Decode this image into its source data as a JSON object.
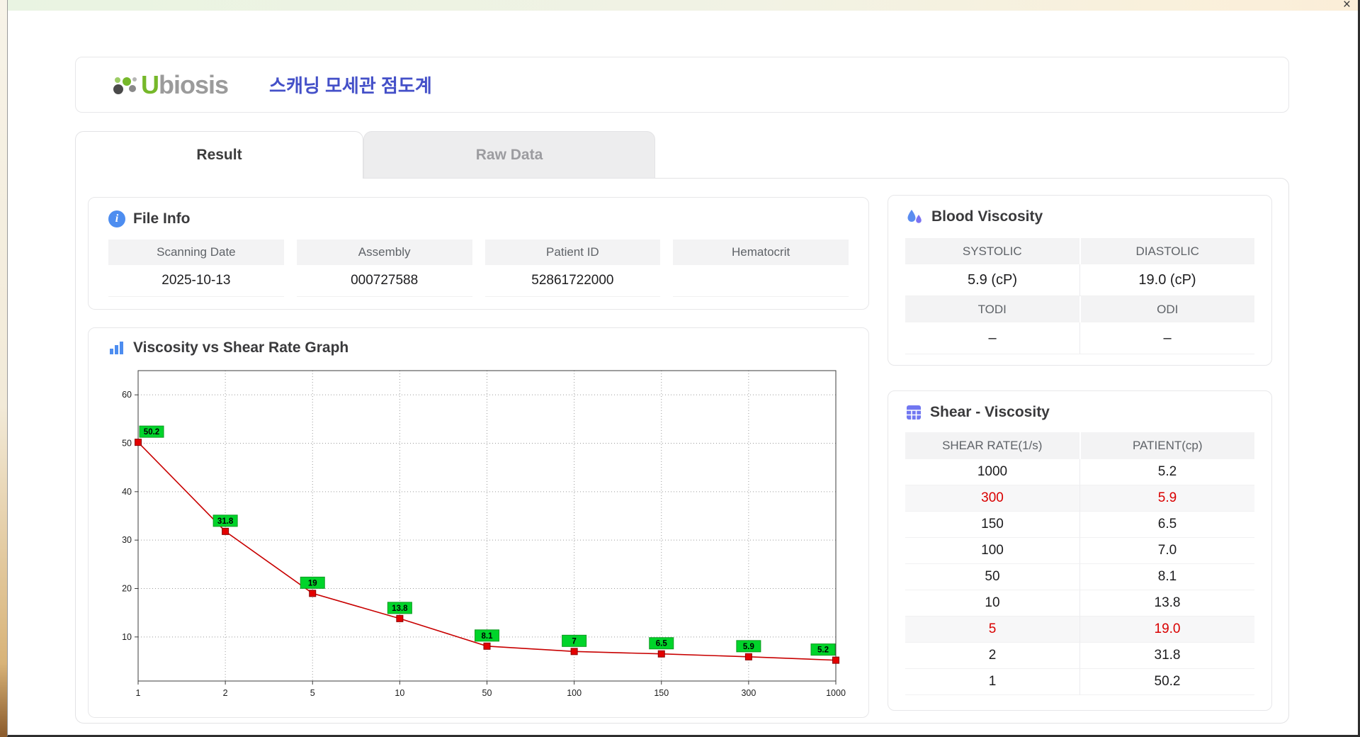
{
  "window": {
    "close_label": "×"
  },
  "header": {
    "logo_u": "U",
    "logo_rest": "biosis",
    "app_title": "스캐닝 모세관 점도계"
  },
  "tabs": [
    {
      "label": "Result",
      "active": true
    },
    {
      "label": "Raw Data",
      "active": false
    }
  ],
  "file_info": {
    "heading": "File Info",
    "fields": [
      {
        "label": "Scanning Date",
        "value": "2025-10-13"
      },
      {
        "label": "Assembly",
        "value": "000727588"
      },
      {
        "label": "Patient ID",
        "value": "52861722000"
      },
      {
        "label": "Hematocrit",
        "value": ""
      }
    ]
  },
  "graph": {
    "heading": "Viscosity vs Shear Rate Graph"
  },
  "blood_viscosity": {
    "heading": "Blood Viscosity",
    "cells": [
      {
        "label": "SYSTOLIC",
        "value": "5.9 (cP)"
      },
      {
        "label": "DIASTOLIC",
        "value": "19.0 (cP)"
      },
      {
        "label": "TODI",
        "value": "–"
      },
      {
        "label": "ODI",
        "value": "–"
      }
    ]
  },
  "shear_viscosity": {
    "heading": "Shear - Viscosity",
    "columns": [
      "SHEAR RATE(1/s)",
      "PATIENT(cp)"
    ],
    "rows": [
      {
        "shear": "1000",
        "patient": "5.2",
        "highlight": false
      },
      {
        "shear": "300",
        "patient": "5.9",
        "highlight": true
      },
      {
        "shear": "150",
        "patient": "6.5",
        "highlight": false
      },
      {
        "shear": "100",
        "patient": "7.0",
        "highlight": false
      },
      {
        "shear": "50",
        "patient": "8.1",
        "highlight": false
      },
      {
        "shear": "10",
        "patient": "13.8",
        "highlight": false
      },
      {
        "shear": "5",
        "patient": "19.0",
        "highlight": true
      },
      {
        "shear": "2",
        "patient": "31.8",
        "highlight": false
      },
      {
        "shear": "1",
        "patient": "50.2",
        "highlight": false
      }
    ]
  },
  "chart_data": {
    "type": "line",
    "title": "Viscosity vs Shear Rate Graph",
    "xlabel": "",
    "ylabel": "",
    "x": [
      1,
      2,
      5,
      10,
      50,
      100,
      150,
      300,
      1000
    ],
    "series": [
      {
        "name": "Patient",
        "values": [
          50.2,
          31.8,
          19,
          13.8,
          8.1,
          7,
          6.5,
          5.9,
          5.2
        ]
      }
    ],
    "point_labels": [
      "50.2",
      "31.8",
      "19",
      "13.8",
      "8.1",
      "7",
      "6.5",
      "5.9",
      "5.2"
    ],
    "x_ticks": [
      1,
      2,
      5,
      10,
      50,
      100,
      150,
      300,
      1000
    ],
    "y_ticks": [
      10,
      20,
      30,
      40,
      50,
      60
    ],
    "ylim": [
      0.9,
      65
    ],
    "x_scale": "ordinal-equal-spacing",
    "grid": "dotted",
    "legend": "none",
    "line_color": "#c80000",
    "marker_color": "#e30000",
    "marker_edge": "#8a0000",
    "label_bg": "#00d42a",
    "label_edge": "#0c9a20"
  }
}
